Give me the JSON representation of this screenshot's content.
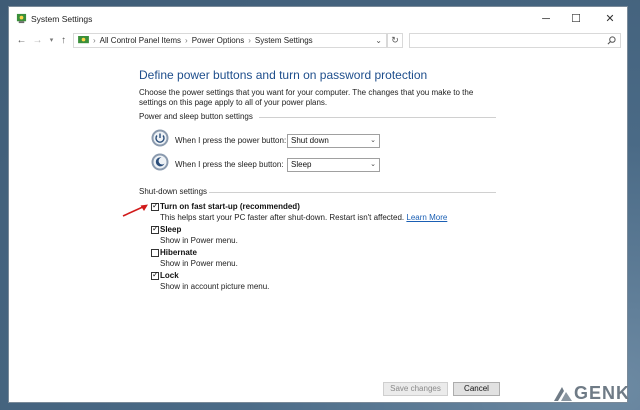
{
  "window": {
    "title": "System Settings"
  },
  "window_controls": {
    "minimize": "─",
    "maximize": "☐",
    "close": "✕"
  },
  "address": {
    "crumbs": [
      "All Control Panel Items",
      "Power Options",
      "System Settings"
    ],
    "separator": "›"
  },
  "page": {
    "heading": "Define power buttons and turn on password protection",
    "intro": "Choose the power settings that you want for your computer. The changes that you make to the settings on this page apply to all of your power plans."
  },
  "power_sleep": {
    "group_label": "Power and sleep button settings",
    "power_button_label": "When I press the power button:",
    "power_button_value": "Shut down",
    "sleep_button_label": "When I press the sleep button:",
    "sleep_button_value": "Sleep"
  },
  "shutdown": {
    "group_label": "Shut-down settings",
    "options": [
      {
        "title": "Turn on fast start-up (recommended)",
        "desc": "This helps start your PC faster after shut-down. Restart isn't affected.",
        "link": "Learn More",
        "checked": true
      },
      {
        "title": "Sleep",
        "desc": "Show in Power menu.",
        "checked": true
      },
      {
        "title": "Hibernate",
        "desc": "Show in Power menu.",
        "checked": false
      },
      {
        "title": "Lock",
        "desc": "Show in account picture menu.",
        "checked": true
      }
    ]
  },
  "footer": {
    "save_label": "Save changes",
    "cancel_label": "Cancel"
  },
  "watermark": {
    "text": "GENK"
  },
  "colors": {
    "heading": "#1e4e8c",
    "link": "#1a5fb4",
    "arrow": "#d11a1a",
    "desktop": "#4a6a86"
  }
}
